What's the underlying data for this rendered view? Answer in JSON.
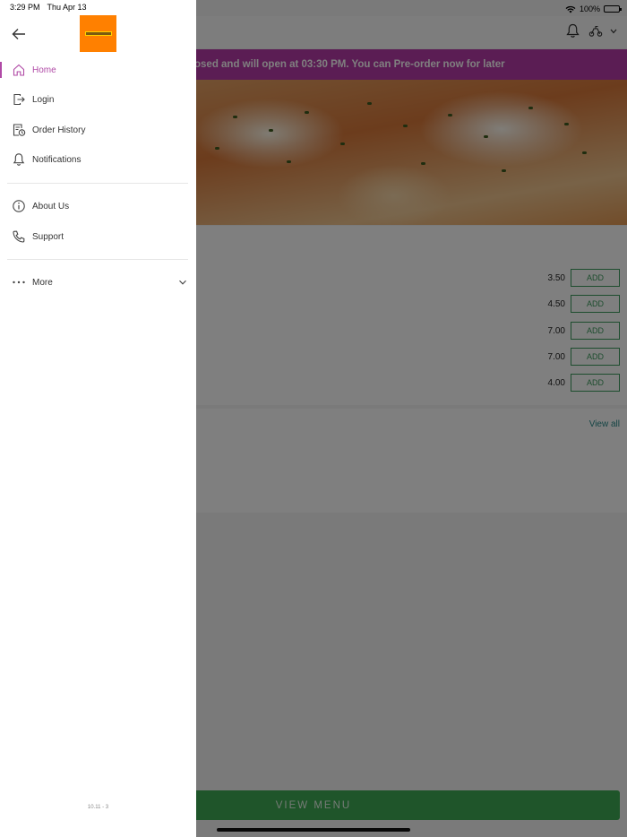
{
  "status_bar": {
    "time": "3:29 PM",
    "date": "Thu Apr 13",
    "battery": "100%"
  },
  "banner": {
    "text": "osed and will open at 03:30 PM. You can Pre-order now for later"
  },
  "products": [
    {
      "price": "3.50",
      "add_label": "ADD"
    },
    {
      "price": "4.50",
      "add_label": "ADD"
    },
    {
      "price": "7.00",
      "add_label": "ADD"
    },
    {
      "price": "7.00",
      "add_label": "ADD"
    },
    {
      "price": "4.00",
      "add_label": "ADD"
    }
  ],
  "section": {
    "view_all": "View all"
  },
  "footer": {
    "view_menu": "VIEW MENU"
  },
  "drawer": {
    "menu": [
      {
        "label": "Home",
        "icon": "home-icon",
        "active": true
      },
      {
        "label": "Login",
        "icon": "login-icon"
      },
      {
        "label": "Order History",
        "icon": "order-history-icon"
      },
      {
        "label": "Notifications",
        "icon": "bell-icon"
      },
      {
        "label": "About Us",
        "icon": "info-icon"
      },
      {
        "label": "Support",
        "icon": "phone-icon"
      },
      {
        "label": "More",
        "icon": "more-dots-icon"
      }
    ],
    "version": "10.11 - 3",
    "accent_color": "#b04aa6"
  },
  "colors": {
    "banner": "#b73aa8",
    "add_button": "#3a9a5c",
    "view_menu": "#3faa55",
    "logo": "#ff8000"
  }
}
